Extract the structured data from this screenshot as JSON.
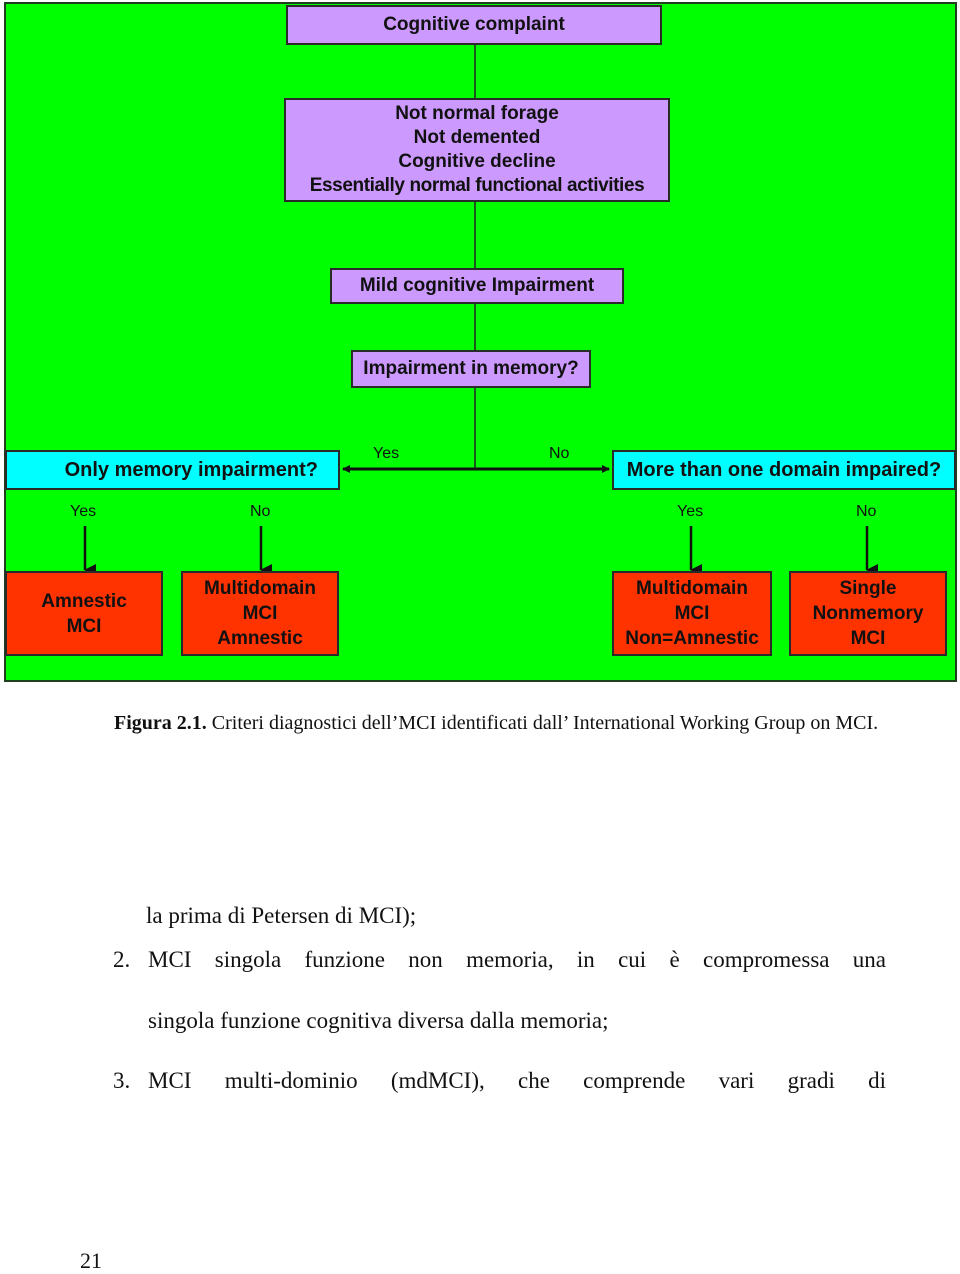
{
  "diagram": {
    "nodes": {
      "cognitive_complaint": "Cognitive complaint",
      "criteria": [
        "Not normal forage",
        "Not demented",
        "Cognitive decline",
        "Essentially normal functional activities"
      ],
      "mci": "Mild cognitive Impairment",
      "memory_question": "Impairment in memory?",
      "only_memory": "Only memory impairment?",
      "more_domains": "More than one domain impaired?",
      "amnestic_mci": [
        "Amnestic",
        "MCI"
      ],
      "multidomain_amnestic": [
        "Multidomain",
        "MCI",
        "Amnestic"
      ],
      "multidomain_non_amnestic": [
        "Multidomain",
        "MCI",
        "Non=Amnestic"
      ],
      "single_nonmemory": [
        "Single",
        "Nonmemory",
        "MCI"
      ]
    },
    "edge_labels": {
      "memory_yes": "Yes",
      "memory_no": "No",
      "only_yes": "Yes",
      "only_no": "No",
      "more_yes": "Yes",
      "more_no": "No"
    },
    "colors": {
      "background": "#00ff00",
      "decision_box": "#cc99ff",
      "question_box": "#00ffff",
      "outcome_box": "#ff3300"
    }
  },
  "caption": {
    "label": "Figura 2.1.",
    "text": " Criteri diagnostici dell’MCI identificati dall’ International Working Group on MCI."
  },
  "body_text": {
    "line1": "la prima di Petersen di MCI);",
    "item2_number": "2.",
    "item2_line1": "MCI singola funzione non memoria, in cui è compromessa una",
    "item2_line2": "singola funzione cognitiva diversa dalla memoria;",
    "item3_number": "3.",
    "item3_line1": "MCI multi-dominio (mdMCI), che comprende vari gradi di"
  },
  "page_number": "21"
}
